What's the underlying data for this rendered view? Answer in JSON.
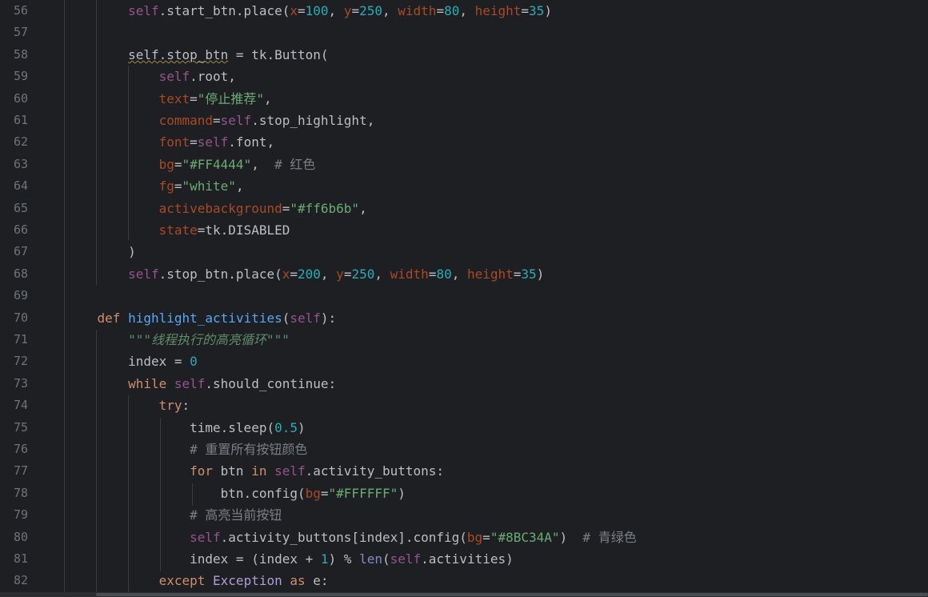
{
  "editor": {
    "lines": [
      {
        "n": "56",
        "t": [
          [
            "        ",
            ""
          ],
          [
            "self",
            "self"
          ],
          [
            ".start_btn.place(",
            ""
          ],
          [
            "x",
            "param"
          ],
          [
            "=",
            ""
          ],
          [
            "100",
            "num"
          ],
          [
            ", ",
            ""
          ],
          [
            "y",
            "param"
          ],
          [
            "=",
            ""
          ],
          [
            "250",
            "num"
          ],
          [
            ", ",
            ""
          ],
          [
            "width",
            "param"
          ],
          [
            "=",
            ""
          ],
          [
            "80",
            "num"
          ],
          [
            ", ",
            ""
          ],
          [
            "height",
            "param"
          ],
          [
            "=",
            ""
          ],
          [
            "35",
            "num"
          ],
          [
            ")",
            ""
          ]
        ]
      },
      {
        "n": "57",
        "t": []
      },
      {
        "n": "58",
        "t": [
          [
            "        ",
            ""
          ],
          [
            "self.stop_btn",
            "warn"
          ],
          [
            " = tk.Button(",
            ""
          ]
        ]
      },
      {
        "n": "59",
        "t": [
          [
            "            ",
            ""
          ],
          [
            "self",
            "self"
          ],
          [
            ".root,",
            ""
          ]
        ]
      },
      {
        "n": "60",
        "t": [
          [
            "            ",
            ""
          ],
          [
            "text",
            "param"
          ],
          [
            "=",
            ""
          ],
          [
            "\"停止推荐\"",
            "str"
          ],
          [
            ",",
            ""
          ]
        ]
      },
      {
        "n": "61",
        "t": [
          [
            "            ",
            ""
          ],
          [
            "command",
            "param"
          ],
          [
            "=",
            ""
          ],
          [
            "self",
            "self"
          ],
          [
            ".stop_highlight,",
            ""
          ]
        ]
      },
      {
        "n": "62",
        "t": [
          [
            "            ",
            ""
          ],
          [
            "font",
            "param"
          ],
          [
            "=",
            ""
          ],
          [
            "self",
            "self"
          ],
          [
            ".font,",
            ""
          ]
        ]
      },
      {
        "n": "63",
        "t": [
          [
            "            ",
            ""
          ],
          [
            "bg",
            "param"
          ],
          [
            "=",
            ""
          ],
          [
            "\"#FF4444\"",
            "str"
          ],
          [
            ",  ",
            ""
          ],
          [
            "# 红色",
            "cmt"
          ]
        ]
      },
      {
        "n": "64",
        "t": [
          [
            "            ",
            ""
          ],
          [
            "fg",
            "param"
          ],
          [
            "=",
            ""
          ],
          [
            "\"white\"",
            "str"
          ],
          [
            ",",
            ""
          ]
        ]
      },
      {
        "n": "65",
        "t": [
          [
            "            ",
            ""
          ],
          [
            "activebackground",
            "param"
          ],
          [
            "=",
            ""
          ],
          [
            "\"#ff6b6b\"",
            "str"
          ],
          [
            ",",
            ""
          ]
        ]
      },
      {
        "n": "66",
        "t": [
          [
            "            ",
            ""
          ],
          [
            "state",
            "param"
          ],
          [
            "=tk.DISABLED",
            ""
          ]
        ]
      },
      {
        "n": "67",
        "t": [
          [
            "        )",
            ""
          ]
        ]
      },
      {
        "n": "68",
        "t": [
          [
            "        ",
            ""
          ],
          [
            "self",
            "self"
          ],
          [
            ".stop_btn.place(",
            ""
          ],
          [
            "x",
            "param"
          ],
          [
            "=",
            ""
          ],
          [
            "200",
            "num"
          ],
          [
            ", ",
            ""
          ],
          [
            "y",
            "param"
          ],
          [
            "=",
            ""
          ],
          [
            "250",
            "num"
          ],
          [
            ", ",
            ""
          ],
          [
            "width",
            "param"
          ],
          [
            "=",
            ""
          ],
          [
            "80",
            "num"
          ],
          [
            ", ",
            ""
          ],
          [
            "height",
            "param"
          ],
          [
            "=",
            ""
          ],
          [
            "35",
            "num"
          ],
          [
            ")",
            ""
          ]
        ]
      },
      {
        "n": "69",
        "t": []
      },
      {
        "n": "70",
        "t": [
          [
            "    ",
            ""
          ],
          [
            "def",
            "kw"
          ],
          [
            " ",
            ""
          ],
          [
            "highlight_activities",
            "fn"
          ],
          [
            "(",
            ""
          ],
          [
            "self",
            "self"
          ],
          [
            "):",
            ""
          ]
        ]
      },
      {
        "n": "71",
        "t": [
          [
            "        ",
            ""
          ],
          [
            "\"\"\"线程执行的高亮循环\"\"\"",
            "doc"
          ]
        ]
      },
      {
        "n": "72",
        "t": [
          [
            "        index = ",
            ""
          ],
          [
            "0",
            "num"
          ]
        ]
      },
      {
        "n": "73",
        "t": [
          [
            "        ",
            ""
          ],
          [
            "while",
            "kw"
          ],
          [
            " ",
            ""
          ],
          [
            "self",
            "self"
          ],
          [
            ".should_continue:",
            ""
          ]
        ]
      },
      {
        "n": "74",
        "t": [
          [
            "            ",
            ""
          ],
          [
            "try",
            "kw"
          ],
          [
            ":",
            ""
          ]
        ]
      },
      {
        "n": "75",
        "t": [
          [
            "                time.sleep(",
            ""
          ],
          [
            "0.5",
            "num"
          ],
          [
            ")",
            ""
          ]
        ]
      },
      {
        "n": "76",
        "t": [
          [
            "                ",
            ""
          ],
          [
            "# 重置所有按钮颜色",
            "cmt"
          ]
        ]
      },
      {
        "n": "77",
        "t": [
          [
            "                ",
            ""
          ],
          [
            "for",
            "kw"
          ],
          [
            " btn ",
            ""
          ],
          [
            "in",
            "kw"
          ],
          [
            " ",
            ""
          ],
          [
            "self",
            "self"
          ],
          [
            ".activity_buttons:",
            ""
          ]
        ]
      },
      {
        "n": "78",
        "t": [
          [
            "                    btn.config(",
            ""
          ],
          [
            "bg",
            "param"
          ],
          [
            "=",
            ""
          ],
          [
            "\"#FFFFFF\"",
            "str"
          ],
          [
            ")",
            ""
          ]
        ]
      },
      {
        "n": "79",
        "t": [
          [
            "                ",
            ""
          ],
          [
            "# 高亮当前按钮",
            "cmt"
          ]
        ]
      },
      {
        "n": "80",
        "t": [
          [
            "                ",
            ""
          ],
          [
            "self",
            "self"
          ],
          [
            ".activity_buttons[index].config(",
            ""
          ],
          [
            "bg",
            "param"
          ],
          [
            "=",
            ""
          ],
          [
            "\"#8BC34A\"",
            "str"
          ],
          [
            ")  ",
            ""
          ],
          [
            "# 青绿色",
            "cmt"
          ]
        ]
      },
      {
        "n": "81",
        "t": [
          [
            "                index = (index + ",
            ""
          ],
          [
            "1",
            "num"
          ],
          [
            ") % ",
            ""
          ],
          [
            "len",
            "builtin"
          ],
          [
            "(",
            ""
          ],
          [
            "self",
            "self"
          ],
          [
            ".activities)",
            ""
          ]
        ]
      },
      {
        "n": "82",
        "t": [
          [
            "            ",
            ""
          ],
          [
            "except",
            "kw"
          ],
          [
            " ",
            ""
          ],
          [
            "Exception",
            "cls"
          ],
          [
            " ",
            ""
          ],
          [
            "as",
            "kw"
          ],
          [
            " e:",
            ""
          ]
        ]
      }
    ]
  }
}
